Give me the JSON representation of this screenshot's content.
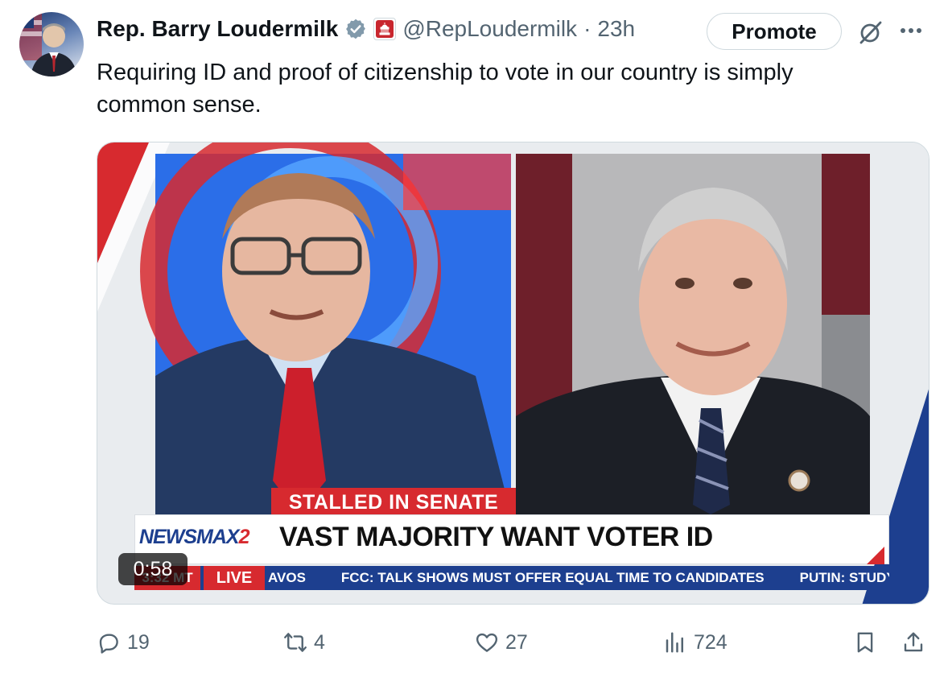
{
  "tweet": {
    "author": {
      "name": "Rep. Barry Loudermilk",
      "handle": "@RepLoudermilk",
      "time": "23h",
      "separator": "·"
    },
    "promote_label": "Promote",
    "text": "Requiring ID and proof of citizenship to vote in our country is simply common sense.",
    "media": {
      "duration": "0:58",
      "overlay": {
        "tag": "STALLED IN SENATE",
        "network_logo": "NEWSMAX",
        "network_logo_suffix": "2",
        "headline": "VAST MAJORITY WANT VOTER ID",
        "ticker_time": "3:32 MT",
        "ticker_live": "LIVE",
        "ticker_items": [
          "AVOS",
          "FCC: TALK SHOWS MUST OFFER EQUAL TIME TO CANDIDATES",
          "PUTIN: STUDYINC"
        ]
      }
    },
    "stats": {
      "replies": "19",
      "reposts": "4",
      "likes": "27",
      "views": "724"
    }
  },
  "icons": {
    "verified": "verified-badge-icon",
    "affiliation": "capitol-affiliation-icon",
    "grok": "grok-icon",
    "more": "more-icon",
    "reply": "reply-icon",
    "repost": "repost-icon",
    "like": "heart-icon",
    "views": "views-icon",
    "bookmark": "bookmark-icon",
    "share": "share-icon"
  },
  "colors": {
    "accent_red": "#d72a2f",
    "newsmax_blue": "#1d3f8f",
    "secondary_text": "#536471",
    "verified_gray": "#829aab"
  }
}
